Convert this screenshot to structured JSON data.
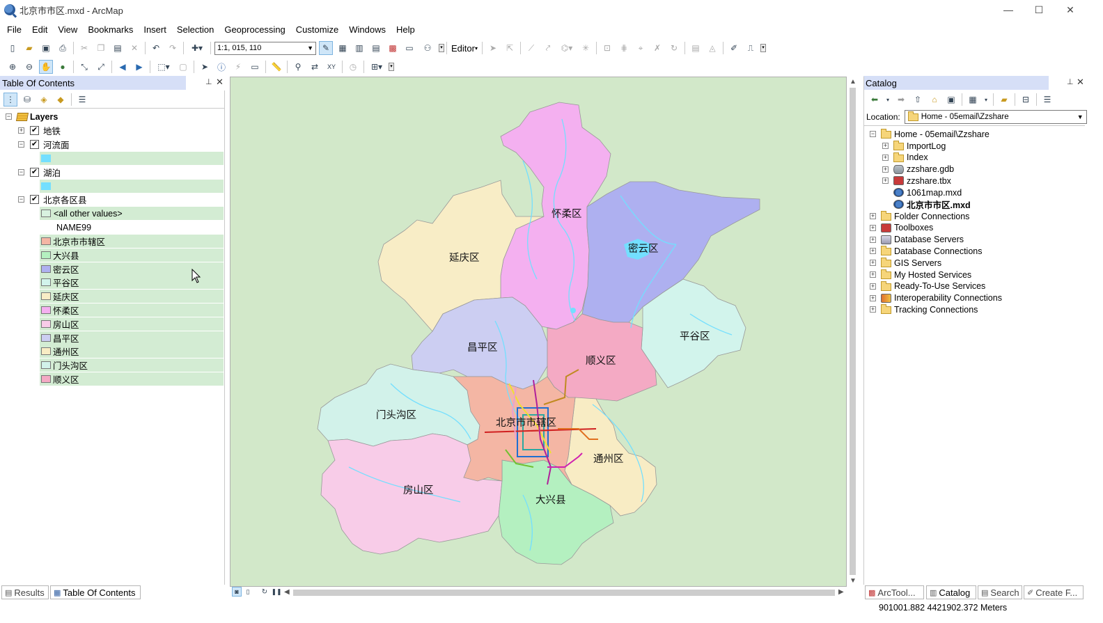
{
  "window": {
    "title": "北京市市区.mxd - ArcMap",
    "minimize": "—",
    "maximize": "☐",
    "close": "✕"
  },
  "menu": [
    "File",
    "Edit",
    "View",
    "Bookmarks",
    "Insert",
    "Selection",
    "Geoprocessing",
    "Customize",
    "Windows",
    "Help"
  ],
  "toolbar": {
    "scale": "1:1, 015, 110",
    "editor_label": "Editor"
  },
  "toc": {
    "title": "Table Of Contents",
    "root": "Layers",
    "layers": [
      {
        "name": "地铁",
        "checked": true,
        "expanded": false
      },
      {
        "name": "河流面",
        "checked": true,
        "expanded": true,
        "symbol_color": "#73dfff"
      },
      {
        "name": "湖泊",
        "checked": true,
        "expanded": true,
        "symbol_color": "#73dfff"
      },
      {
        "name": "北京各区县",
        "checked": true,
        "expanded": true,
        "field": "NAME99",
        "other": "<all other values>",
        "classes": [
          {
            "label": "北京市市辖区",
            "color": "#f4b6a4"
          },
          {
            "label": "大兴县",
            "color": "#b4f0c0"
          },
          {
            "label": "密云区",
            "color": "#aeb0f0"
          },
          {
            "label": "平谷区",
            "color": "#d2f4ec"
          },
          {
            "label": "延庆区",
            "color": "#f8edc6"
          },
          {
            "label": "怀柔区",
            "color": "#f4b0f0"
          },
          {
            "label": "房山区",
            "color": "#f8cce8"
          },
          {
            "label": "昌平区",
            "color": "#cccef2"
          },
          {
            "label": "通州区",
            "color": "#f8ecc4"
          },
          {
            "label": "门头沟区",
            "color": "#d2f2ea"
          },
          {
            "label": "顺义区",
            "color": "#f4aac4"
          }
        ]
      }
    ]
  },
  "map": {
    "background": "#d2e8c9",
    "labels": [
      "怀柔区",
      "密云区",
      "延庆区",
      "平谷区",
      "昌平区",
      "顺义区",
      "门头沟区",
      "北京市市辖区",
      "通州区",
      "房山区",
      "大兴县"
    ]
  },
  "catalog": {
    "title": "Catalog",
    "location_label": "Location:",
    "location_value": "Home - 05email\\Zzshare",
    "home": "Home - 05email\\Zzshare",
    "home_children": [
      {
        "label": "ImportLog",
        "icon": "folder-icon"
      },
      {
        "label": "Index",
        "icon": "folder-icon"
      },
      {
        "label": "zzshare.gdb",
        "icon": "geodatabase-icon"
      },
      {
        "label": "zzshare.tbx",
        "icon": "toolbox-icon"
      },
      {
        "label": "1061map.mxd",
        "icon": "map-document-icon"
      },
      {
        "label": "北京市市区.mxd",
        "icon": "map-document-icon",
        "bold": true
      }
    ],
    "roots": [
      {
        "label": "Folder Connections",
        "icon": "folder-connections-icon"
      },
      {
        "label": "Toolboxes",
        "icon": "toolboxes-icon"
      },
      {
        "label": "Database Servers",
        "icon": "database-servers-icon"
      },
      {
        "label": "Database Connections",
        "icon": "database-connections-icon"
      },
      {
        "label": "GIS Servers",
        "icon": "gis-servers-icon"
      },
      {
        "label": "My Hosted Services",
        "icon": "hosted-services-icon"
      },
      {
        "label": "Ready-To-Use Services",
        "icon": "ready-services-icon"
      },
      {
        "label": "Interoperability Connections",
        "icon": "interop-icon"
      },
      {
        "label": "Tracking Connections",
        "icon": "tracking-icon"
      }
    ]
  },
  "bottom_tabs_left": [
    "Results",
    "Table Of Contents"
  ],
  "bottom_tabs_right": [
    "ArcTool...",
    "Catalog",
    "Search",
    "Create F..."
  ],
  "status": {
    "coords": "901001.882  4421902.372 Meters"
  }
}
